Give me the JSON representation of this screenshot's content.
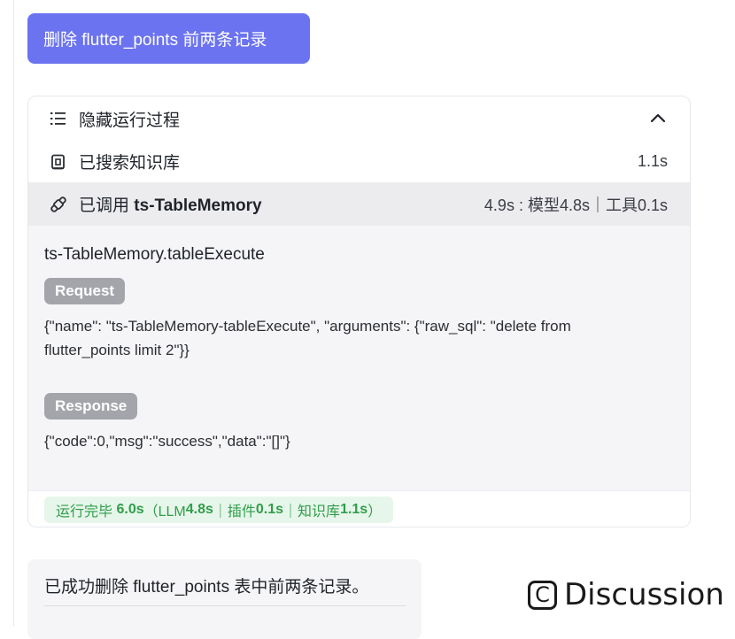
{
  "user_message": "删除 flutter_points 前两条记录",
  "run_panel": {
    "toggle_label": "隐藏运行过程",
    "knowledge": {
      "label": "已搜索知识库",
      "duration": "1.1s"
    },
    "plugin": {
      "label_prefix": "已调用",
      "plugin_name": "ts-TableMemory",
      "timing": "4.9s : 模型4.8s｜工具0.1s"
    },
    "detail": {
      "function_name": "ts-TableMemory.tableExecute",
      "request_label": "Request",
      "request_body": "{\"name\": \"ts-TableMemory-tableExecute\", \"arguments\": {\"raw_sql\": \"delete from flutter_points limit 2\"}}",
      "response_label": "Response",
      "response_body": "{\"code\":0,\"msg\":\"success\",\"data\":\"[]\"}"
    },
    "summary": {
      "prefix": "运行完毕",
      "total": "6.0s",
      "detail_open": "（LLM ",
      "llm": "4.8s",
      "sep1": "｜插件 ",
      "plugin": "0.1s",
      "sep2": "｜知识库 ",
      "kb": "1.1s",
      "detail_close": "）"
    }
  },
  "answer": {
    "text": "已成功删除 flutter_points 表中前两条记录。"
  },
  "watermark": {
    "letter": "C",
    "text": "Discussion"
  },
  "colors": {
    "accent": "#6b73f0",
    "success": "#2f9e4b",
    "badge": "#a3a5ab"
  },
  "icons": {
    "toggle": "list-icon",
    "collapse": "chevron-up-icon",
    "knowledge": "knowledge-base-icon",
    "plugin": "plugin-link-icon"
  }
}
